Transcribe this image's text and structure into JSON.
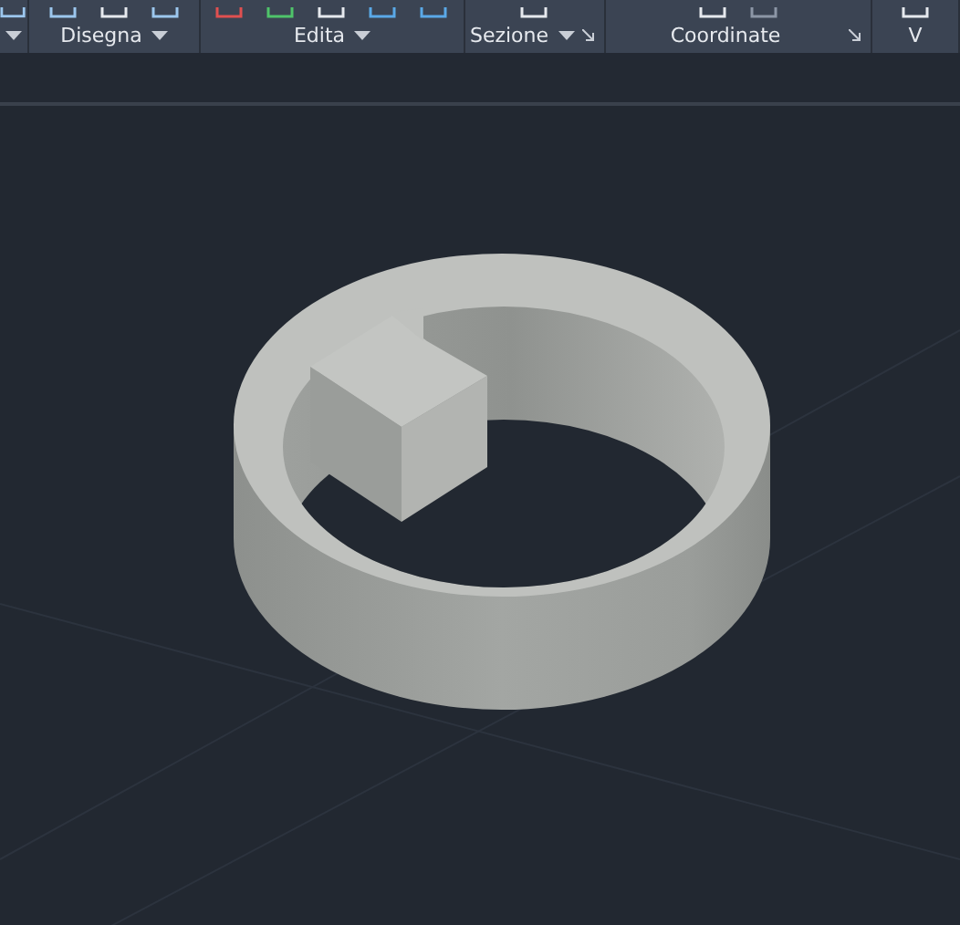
{
  "ribbon": {
    "panels": [
      {
        "dropdown": true,
        "launcher": false
      },
      {
        "label": "Disegna",
        "dropdown": true,
        "launcher": false
      },
      {
        "label": "Edita",
        "dropdown": true,
        "launcher": false
      },
      {
        "label": "Sezione",
        "dropdown": true,
        "launcher": true
      },
      {
        "label": "Coordinate",
        "dropdown": false,
        "launcher": true
      },
      {
        "label": "V",
        "dropdown": false,
        "launcher": false
      }
    ]
  }
}
